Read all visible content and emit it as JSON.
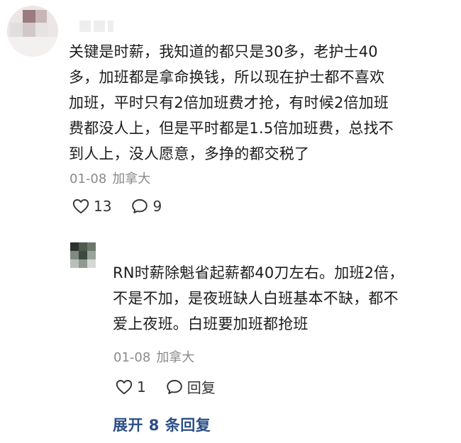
{
  "comment": {
    "text": "关键是时薪，我知道的都只是30多，老护士40\n多，加班都是拿命换钱，所以现在护士都不喜欢\n加班，平时只有2倍加班费才抢，有时候2倍加班\n费都没人上，但是平时都是1.5倍加班费，总找不\n到人上，没人愿意，多挣的都交税了",
    "date": "01-08",
    "location": "加拿大",
    "likes": "13",
    "replies": "9"
  },
  "reply": {
    "text": "RN时薪除魁省起薪都40刀左右。加班2倍，\n不是不加，是夜班缺人白班基本不缺，都不\n爱上夜班。白班要加班都抢班",
    "date": "01-08",
    "location": "加拿大",
    "likes": "1",
    "reply_label": "回复"
  },
  "expand_label": "展开 8 条回复",
  "icons": {
    "like": "heart-outline-icon",
    "comment": "speech-bubble-icon"
  },
  "colors": {
    "text": "#1c1c1c",
    "meta": "#8a8a8a",
    "link": "#2b4e86"
  }
}
